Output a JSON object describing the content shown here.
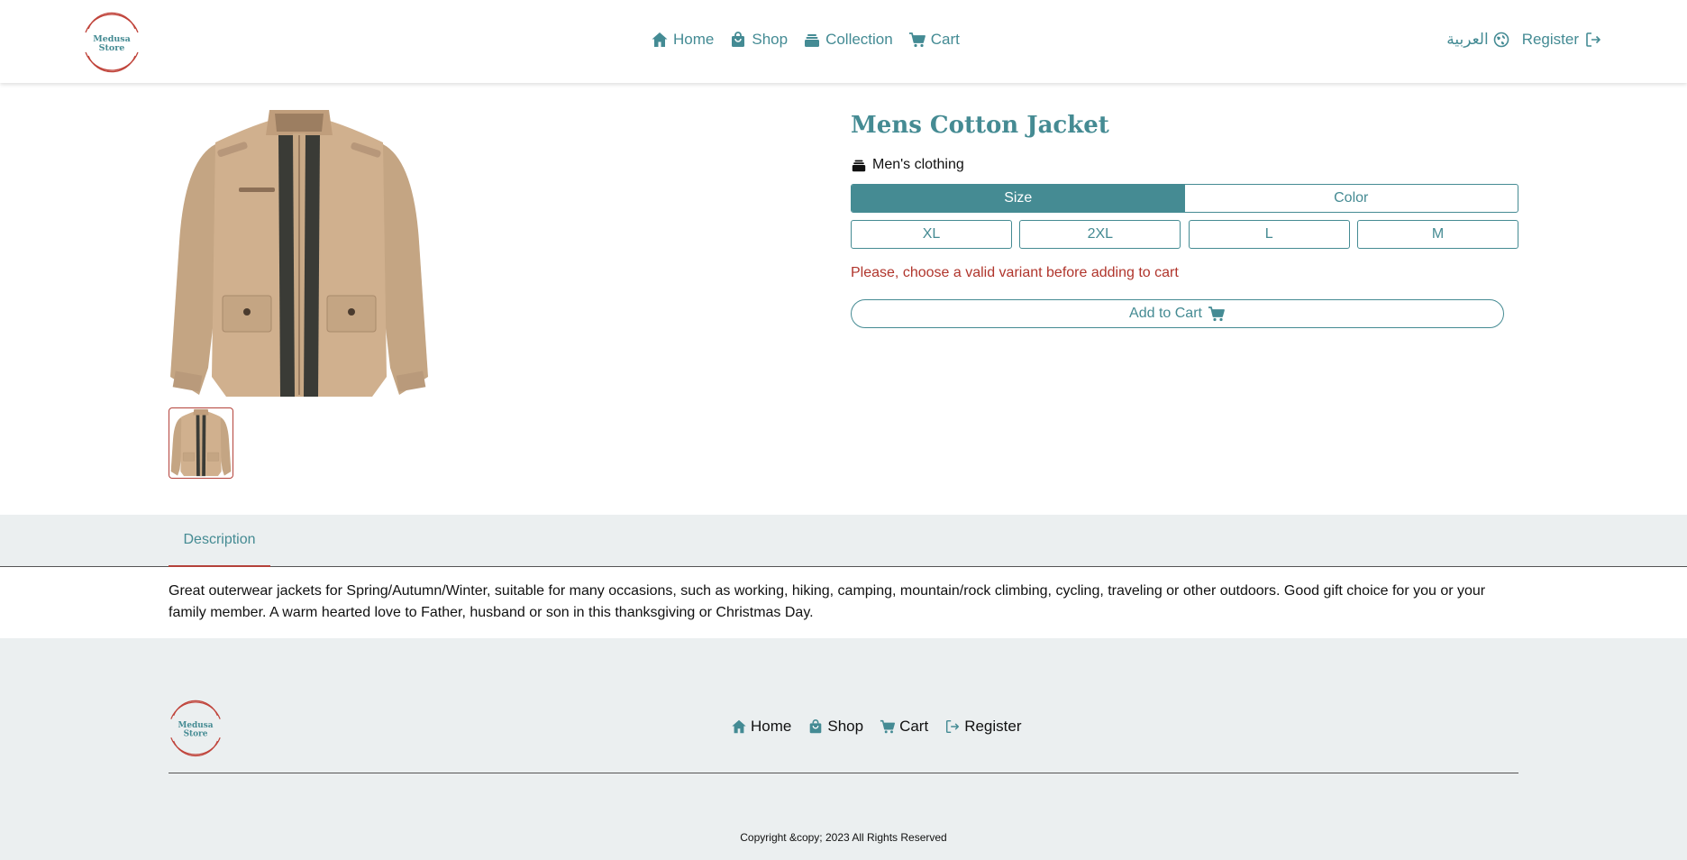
{
  "brand": {
    "logo_line1": "Medusa",
    "logo_line2": "Store"
  },
  "header": {
    "nav": [
      {
        "label": "Home",
        "icon": "home-icon"
      },
      {
        "label": "Shop",
        "icon": "shopping-bag-icon"
      },
      {
        "label": "Collection",
        "icon": "collection-icon"
      },
      {
        "label": "Cart",
        "icon": "cart-icon"
      }
    ],
    "language_label": "العربية",
    "language_icon": "globe-icon",
    "register_label": "Register",
    "register_icon": "sign-in-icon"
  },
  "product": {
    "title": "Mens Cotton Jacket",
    "category": "Men's clothing",
    "variant_tabs": [
      "Size",
      "Color"
    ],
    "active_variant_tab": "Size",
    "sizes": [
      "XL",
      "2XL",
      "L",
      "M"
    ],
    "error_message": "Please, choose a valid variant before adding to cart",
    "add_to_cart_label": "Add to Cart"
  },
  "description": {
    "tab_label": "Description",
    "text": "Great outerwear jackets for Spring/Autumn/Winter, suitable for many occasions, such as working, hiking, camping, mountain/rock climbing, cycling, traveling or other outdoors. Good gift choice for you or your family member. A warm hearted love to Father, husband or son in this thanksgiving or Christmas Day."
  },
  "footer": {
    "nav": [
      {
        "label": "Home",
        "icon": "home-icon"
      },
      {
        "label": "Shop",
        "icon": "shopping-bag-icon"
      },
      {
        "label": "Cart",
        "icon": "cart-icon"
      },
      {
        "label": "Register",
        "icon": "sign-in-icon"
      }
    ],
    "copyright": "Copyright &copy; 2023 All Rights Reserved"
  },
  "colors": {
    "accent": "#458b93",
    "brand_red": "#b4423a",
    "error": "#b0352c",
    "band": "#ebeff0"
  }
}
